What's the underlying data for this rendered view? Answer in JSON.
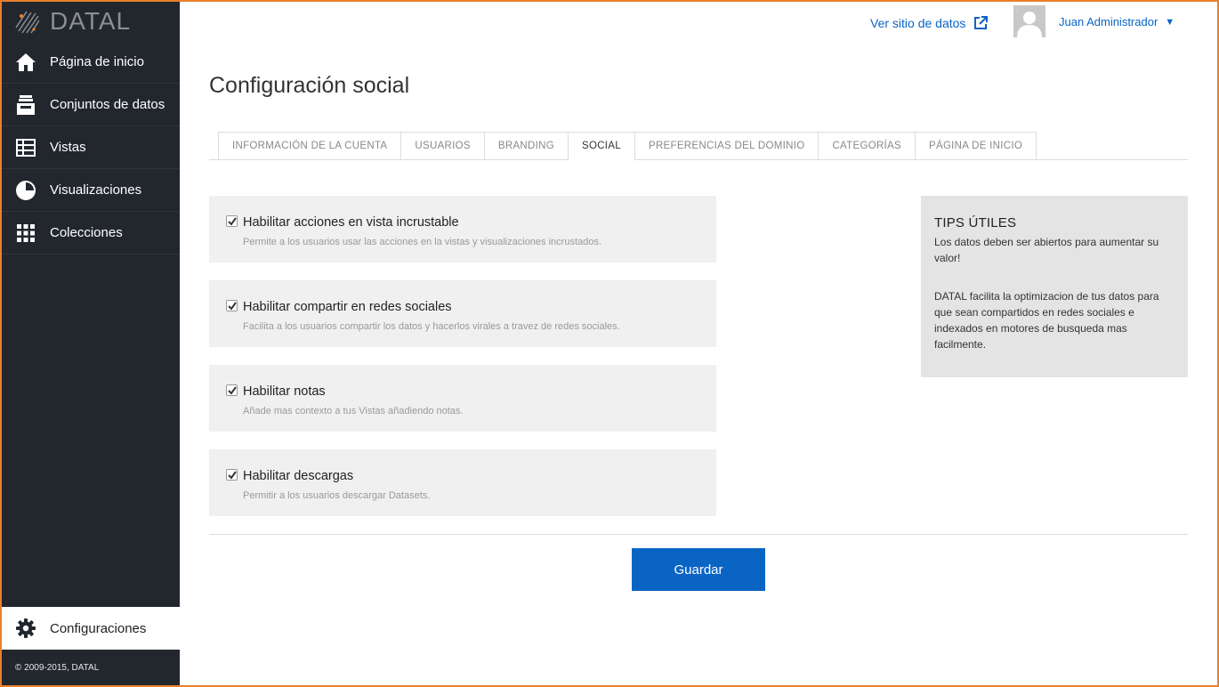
{
  "brand": {
    "name": "DATAL"
  },
  "sidebar": {
    "items": [
      {
        "label": "Página de inicio",
        "icon": "home-icon"
      },
      {
        "label": "Conjuntos de datos",
        "icon": "inbox-icon"
      },
      {
        "label": "Vistas",
        "icon": "table-icon"
      },
      {
        "label": "Visualizaciones",
        "icon": "pie-chart-icon"
      },
      {
        "label": "Colecciones",
        "icon": "grid-icon"
      }
    ],
    "settings_label": "Configuraciones",
    "copyright": "© 2009-2015, DATAL"
  },
  "header": {
    "site_link": "Ver sitio de datos",
    "user_name": "Juan Administrador",
    "caret": "▼"
  },
  "page": {
    "title": "Configuración social"
  },
  "tabs": [
    {
      "label": "INFORMACIÓN DE LA CUENTA",
      "active": false
    },
    {
      "label": "USUARIOS",
      "active": false
    },
    {
      "label": "BRANDING",
      "active": false
    },
    {
      "label": "SOCIAL",
      "active": true
    },
    {
      "label": "PREFERENCIAS DEL DOMINIO",
      "active": false
    },
    {
      "label": "CATEGORÍAS",
      "active": false
    },
    {
      "label": "PÁGINA DE INICIO",
      "active": false
    }
  ],
  "options": [
    {
      "title": "Habilitar acciones en vista incrustable",
      "desc": "Permite a los usuarios usar las acciones en la vistas y visualizaciones incrustados.",
      "checked": true
    },
    {
      "title": "Habilitar compartir en redes sociales",
      "desc": "Facilita a los usuarios compartir los datos y hacerlos virales a travez de redes sociales.",
      "checked": true
    },
    {
      "title": "Habilitar notas",
      "desc": "Añade mas contexto a tus Vistas añadiendo notas.",
      "checked": true
    },
    {
      "title": "Habilitar descargas",
      "desc": "Permitir a los usuarios descargar Datasets.",
      "checked": true
    }
  ],
  "tips": {
    "title": "TIPS ÚTILES",
    "p1": "Los datos deben ser abiertos para aumentar su valor!",
    "p2": "DATAL facilita la optimizacion de tus datos para que sean compartidos en redes sociales e indexados en motores de busqueda mas facilmente."
  },
  "actions": {
    "save_label": "Guardar"
  },
  "colors": {
    "accent": "#0a64c4",
    "sidebar": "#22272e",
    "frame": "#e8802a"
  }
}
